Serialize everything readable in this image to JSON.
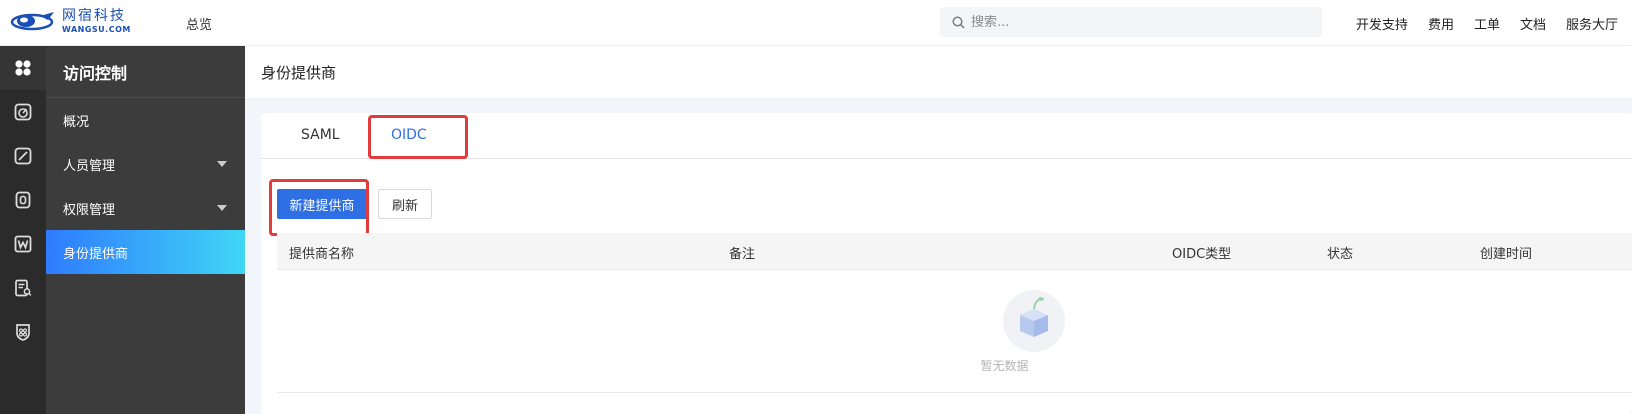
{
  "logo": {
    "name_cn": "网宿科技",
    "name_en": "WANGSU.COM"
  },
  "header": {
    "overview": "总览",
    "search_placeholder": "搜索...",
    "nav": [
      "开发支持",
      "费用",
      "工单",
      "文档",
      "服务大厅"
    ]
  },
  "rail_icons": [
    "apps-icon",
    "dashboard-icon",
    "edit-icon",
    "storage-icon",
    "w-icon",
    "document-search-icon",
    "shield-icon"
  ],
  "sidebar": {
    "title": "访问控制",
    "items": [
      {
        "label": "概况",
        "expandable": false,
        "active": false
      },
      {
        "label": "人员管理",
        "expandable": true,
        "active": false
      },
      {
        "label": "权限管理",
        "expandable": true,
        "active": false
      },
      {
        "label": "身份提供商",
        "expandable": false,
        "active": true
      }
    ]
  },
  "page": {
    "title": "身份提供商",
    "tabs": [
      {
        "label": "SAML",
        "active": false
      },
      {
        "label": "OIDC",
        "active": true
      }
    ],
    "buttons": {
      "create": "新建提供商",
      "refresh": "刷新"
    },
    "table": {
      "columns": [
        "提供商名称",
        "备注",
        "OIDC类型",
        "状态",
        "创建时间"
      ],
      "rows": [],
      "empty_text": "暂无数据"
    }
  },
  "colors": {
    "primary": "#2f6fe4",
    "highlight": "#e23b3b",
    "sidebar_bg": "#3c3c3c",
    "rail_bg": "#2b2b2b",
    "active_gradient_start": "#2f7bff",
    "active_gradient_end": "#3fd6f5"
  }
}
